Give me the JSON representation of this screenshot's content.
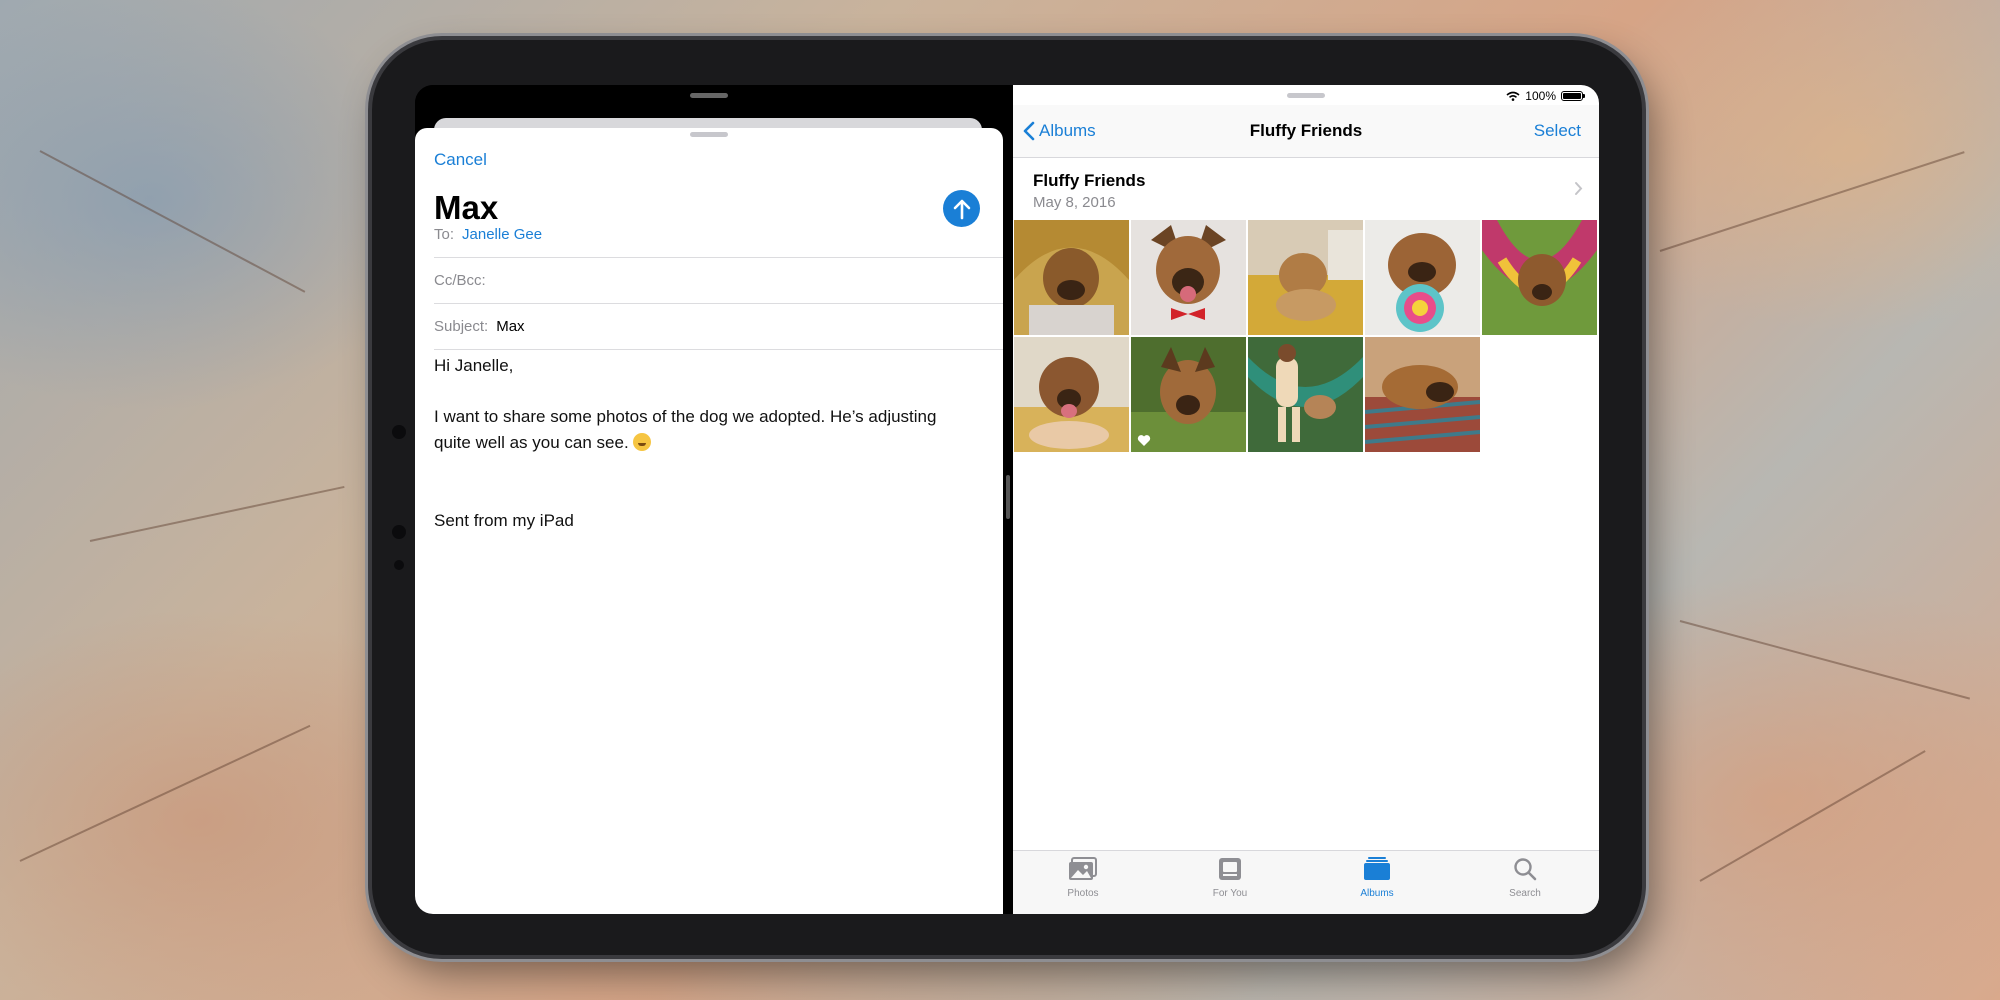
{
  "mail": {
    "cancel_label": "Cancel",
    "title": "Max",
    "to_label": "To:",
    "to_value": "Janelle Gee",
    "ccbcc_label": "Cc/Bcc:",
    "subject_label": "Subject:",
    "subject_value": "Max",
    "greeting": "Hi Janelle,",
    "body_line": "I want to share some photos of the dog we adopted. He’s adjusting quite well as you can see.",
    "signature": "Sent from my iPad"
  },
  "photos": {
    "status_battery": "100%",
    "back_label": "Albums",
    "title": "Fluffy Friends",
    "select_label": "Select",
    "album_name": "Fluffy Friends",
    "album_date": "May 8, 2016",
    "tabs": [
      {
        "label": "Photos",
        "icon": "photos-icon",
        "active": false
      },
      {
        "label": "For You",
        "icon": "for-you-icon",
        "active": false
      },
      {
        "label": "Albums",
        "icon": "albums-icon",
        "active": true
      },
      {
        "label": "Search",
        "icon": "search-icon",
        "active": false
      }
    ]
  },
  "colors": {
    "accent": "#1a7fd6",
    "secondary_text": "#8a8a8f"
  }
}
